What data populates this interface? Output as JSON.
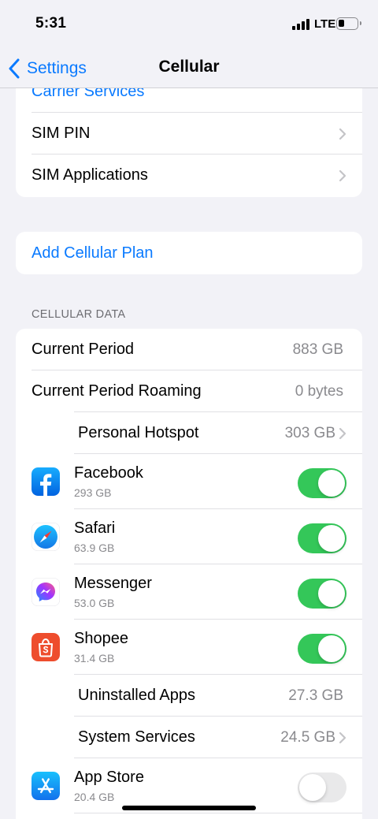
{
  "status_bar": {
    "time": "5:31",
    "network": "LTE"
  },
  "nav": {
    "back_label": "Settings",
    "title": "Cellular"
  },
  "carrier_group": {
    "carrier_services": "Carrier Services",
    "sim_pin": "SIM PIN",
    "sim_applications": "SIM Applications"
  },
  "plan_group": {
    "add_plan": "Add Cellular Plan"
  },
  "cellular_data": {
    "header": "CELLULAR DATA",
    "current_period": {
      "label": "Current Period",
      "value": "883 GB"
    },
    "current_period_roaming": {
      "label": "Current Period Roaming",
      "value": "0 bytes"
    },
    "personal_hotspot": {
      "label": "Personal Hotspot",
      "value": "303 GB"
    },
    "apps": [
      {
        "name": "Facebook",
        "size": "293 GB",
        "enabled": true,
        "icon": "facebook-icon"
      },
      {
        "name": "Safari",
        "size": "63.9 GB",
        "enabled": true,
        "icon": "safari-icon"
      },
      {
        "name": "Messenger",
        "size": "53.0 GB",
        "enabled": true,
        "icon": "messenger-icon"
      },
      {
        "name": "Shopee",
        "size": "31.4 GB",
        "enabled": true,
        "icon": "shopee-icon"
      }
    ],
    "uninstalled_apps": {
      "label": "Uninstalled Apps",
      "value": "27.3 GB"
    },
    "system_services": {
      "label": "System Services",
      "value": "24.5 GB"
    },
    "app_store": {
      "name": "App Store",
      "size": "20.4 GB",
      "enabled": false,
      "icon": "app-store-icon"
    }
  },
  "colors": {
    "accent": "#0a7aff",
    "toggle_on": "#34c759",
    "background": "#f2f2f7"
  }
}
